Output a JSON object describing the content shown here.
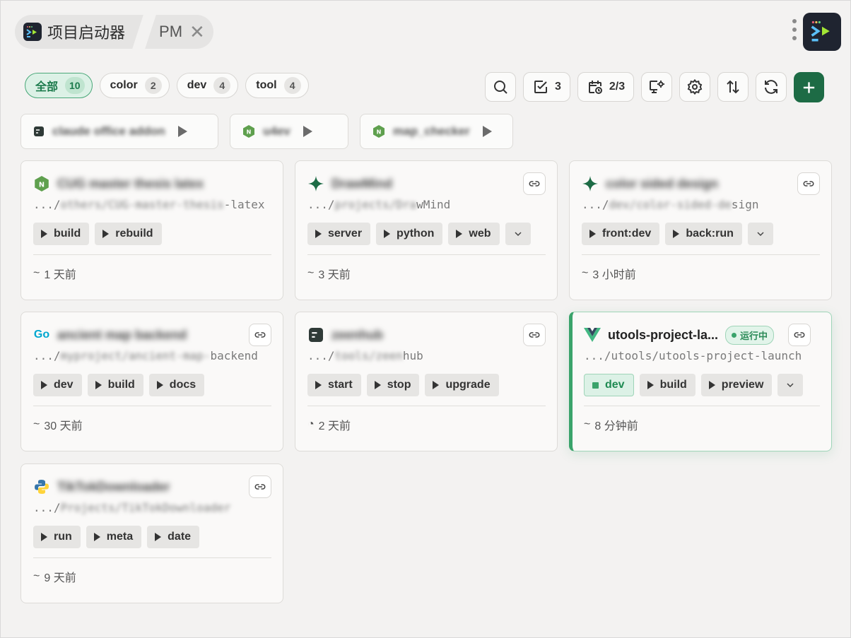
{
  "breadcrumb": {
    "app_title": "项目启动器",
    "tab": "PM"
  },
  "filters": [
    {
      "label": "全部",
      "count": "10"
    },
    {
      "label": "color",
      "count": "2"
    },
    {
      "label": "dev",
      "count": "4"
    },
    {
      "label": "tool",
      "count": "4"
    }
  ],
  "toolbar": {
    "tasks_count": "3",
    "schedule_count": "2/3"
  },
  "pinned": [
    {
      "name": "claude office addon"
    },
    {
      "name": "u4ev"
    },
    {
      "name": "map_checker"
    }
  ],
  "cards": [
    {
      "title": "CUG master thesis latex",
      "path_prefix": ".../",
      "path_hidden": "others/CUG-master-thesis",
      "path_tail": "-latex",
      "commands": [
        "build",
        "rebuild"
      ],
      "time": "1 天前"
    },
    {
      "title": "DrawMind",
      "path_prefix": ".../",
      "path_hidden": "projects/Dra",
      "path_tail": "wMind",
      "commands": [
        "server",
        "python",
        "web"
      ],
      "time": "3 天前"
    },
    {
      "title": "color sided design",
      "path_prefix": ".../",
      "path_hidden": "dev/color-sided-de",
      "path_tail": "sign",
      "commands": [
        "front:dev",
        "back:run"
      ],
      "time": "3 小时前"
    },
    {
      "title": "ancient map backend",
      "path_prefix": ".../",
      "path_hidden": "myproject/ancient-map-",
      "path_tail": "backend",
      "commands": [
        "dev",
        "build",
        "docs"
      ],
      "time": "30 天前",
      "icon_text": "Go"
    },
    {
      "title": "zeenhub",
      "path_prefix": ".../",
      "path_hidden": "tools/zeen",
      "path_tail": "hub",
      "commands": [
        "start",
        "stop",
        "upgrade"
      ],
      "time": "2 天前"
    },
    {
      "title": "utools-project-la...",
      "path_prefix": ".../",
      "path_hidden": "",
      "path_tail": "utools/utools-project-launch",
      "commands": [
        "dev",
        "build",
        "preview"
      ],
      "time": "8 分钟前",
      "status": "运行中"
    },
    {
      "title": "TikTokDownloader",
      "path_prefix": ".../",
      "path_hidden": "Pro",
      "path_tail": "jects/TikTokDownloader",
      "commands": [
        "run",
        "meta",
        "date"
      ],
      "time": "9 天前"
    }
  ],
  "colors": {
    "accent": "#1d6b45",
    "running": "#3aa36b",
    "background": "#f3f2f1"
  }
}
